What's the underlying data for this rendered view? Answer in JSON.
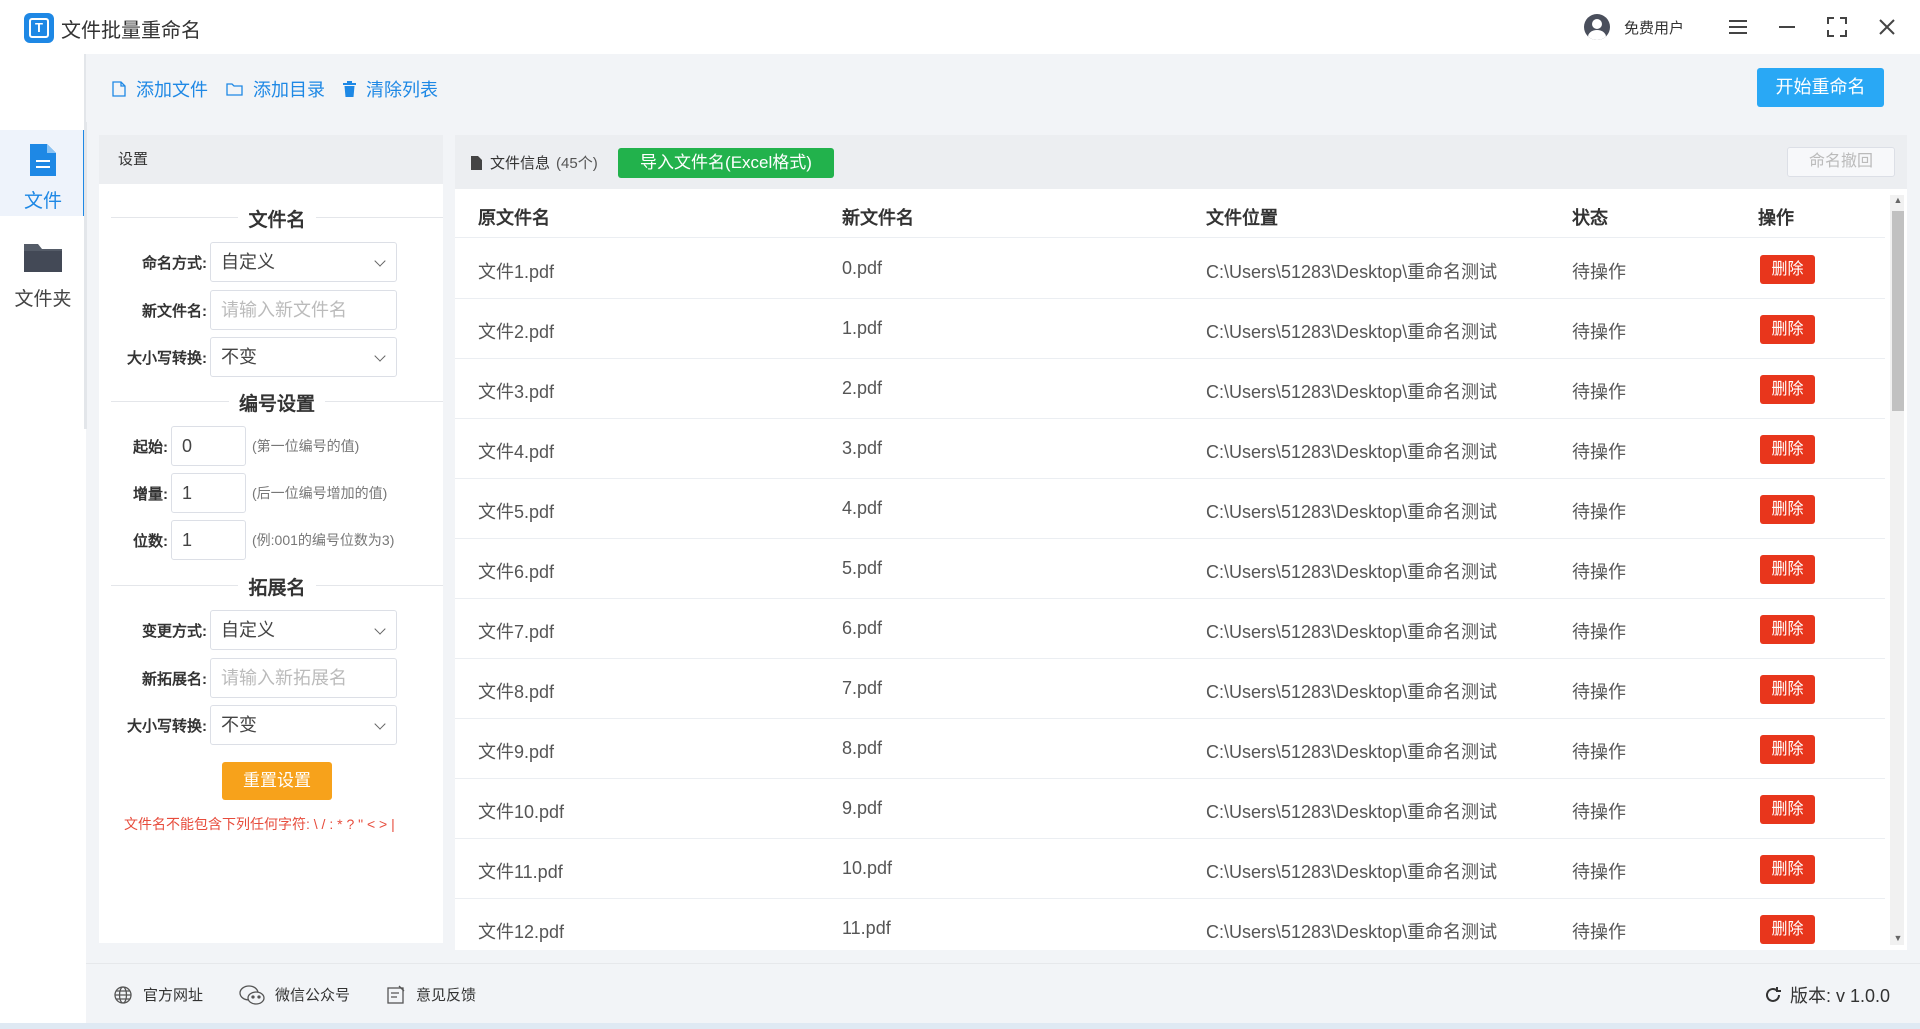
{
  "app": {
    "title": "文件批量重命名",
    "logo_text": "T"
  },
  "user": {
    "label": "免费用户"
  },
  "window_controls": [
    "menu",
    "minimize",
    "maximize",
    "close"
  ],
  "rail": [
    {
      "label": "文件",
      "icon": "file-icon",
      "active": true
    },
    {
      "label": "文件夹",
      "icon": "folder-icon",
      "active": false
    }
  ],
  "toolbar": {
    "add_file": "添加文件",
    "add_dir": "添加目录",
    "clear_list": "清除列表",
    "start": "开始重命名"
  },
  "settings": {
    "header": "设置",
    "filename": {
      "title": "文件名",
      "mode_label": "命名方式:",
      "mode_value": "自定义",
      "new_name_label": "新文件名:",
      "new_name_placeholder": "请输入新文件名",
      "case_label": "大小写转换:",
      "case_value": "不变"
    },
    "numbering": {
      "title": "编号设置",
      "start_label": "起始:",
      "start_value": "0",
      "start_hint": "(第一位编号的值)",
      "step_label": "增量:",
      "step_value": "1",
      "step_hint": "(后一位编号增加的值)",
      "digits_label": "位数:",
      "digits_value": "1",
      "digits_hint": "(例:001的编号位数为3)"
    },
    "extension": {
      "title": "拓展名",
      "mode_label": "变更方式:",
      "mode_value": "自定义",
      "new_ext_label": "新拓展名:",
      "new_ext_placeholder": "请输入新拓展名",
      "case_label": "大小写转换:",
      "case_value": "不变"
    },
    "reset": "重置设置",
    "warning": "文件名不能包含下列任何字符: \\ / : * ? \" < > |"
  },
  "files": {
    "info_label": "文件信息",
    "count": "(45个)",
    "import_label": "导入文件名(Excel格式)",
    "undo_label": "命名撤回",
    "columns": [
      "原文件名",
      "新文件名",
      "文件位置",
      "状态",
      "操作"
    ],
    "delete_label": "删除",
    "rows": [
      {
        "orig": "文件1.pdf",
        "new": "0.pdf",
        "path": "C:\\Users\\51283\\Desktop\\重命名测试",
        "status": "待操作"
      },
      {
        "orig": "文件2.pdf",
        "new": "1.pdf",
        "path": "C:\\Users\\51283\\Desktop\\重命名测试",
        "status": "待操作"
      },
      {
        "orig": "文件3.pdf",
        "new": "2.pdf",
        "path": "C:\\Users\\51283\\Desktop\\重命名测试",
        "status": "待操作"
      },
      {
        "orig": "文件4.pdf",
        "new": "3.pdf",
        "path": "C:\\Users\\51283\\Desktop\\重命名测试",
        "status": "待操作"
      },
      {
        "orig": "文件5.pdf",
        "new": "4.pdf",
        "path": "C:\\Users\\51283\\Desktop\\重命名测试",
        "status": "待操作"
      },
      {
        "orig": "文件6.pdf",
        "new": "5.pdf",
        "path": "C:\\Users\\51283\\Desktop\\重命名测试",
        "status": "待操作"
      },
      {
        "orig": "文件7.pdf",
        "new": "6.pdf",
        "path": "C:\\Users\\51283\\Desktop\\重命名测试",
        "status": "待操作"
      },
      {
        "orig": "文件8.pdf",
        "new": "7.pdf",
        "path": "C:\\Users\\51283\\Desktop\\重命名测试",
        "status": "待操作"
      },
      {
        "orig": "文件9.pdf",
        "new": "8.pdf",
        "path": "C:\\Users\\51283\\Desktop\\重命名测试",
        "status": "待操作"
      },
      {
        "orig": "文件10.pdf",
        "new": "9.pdf",
        "path": "C:\\Users\\51283\\Desktop\\重命名测试",
        "status": "待操作"
      },
      {
        "orig": "文件11.pdf",
        "new": "10.pdf",
        "path": "C:\\Users\\51283\\Desktop\\重命名测试",
        "status": "待操作"
      },
      {
        "orig": "文件12.pdf",
        "new": "11.pdf",
        "path": "C:\\Users\\51283\\Desktop\\重命名测试",
        "status": "待操作"
      }
    ]
  },
  "footer": {
    "website": "官方网址",
    "wechat": "微信公众号",
    "feedback": "意见反馈",
    "version": "版本: v 1.0.0"
  },
  "colors": {
    "accent": "#1e88e5",
    "start_button": "#29a8f5",
    "import_button": "#22b24c",
    "delete_button": "#e8361c",
    "reset_button": "#f7a21b",
    "warning_text": "#e74c3c"
  }
}
